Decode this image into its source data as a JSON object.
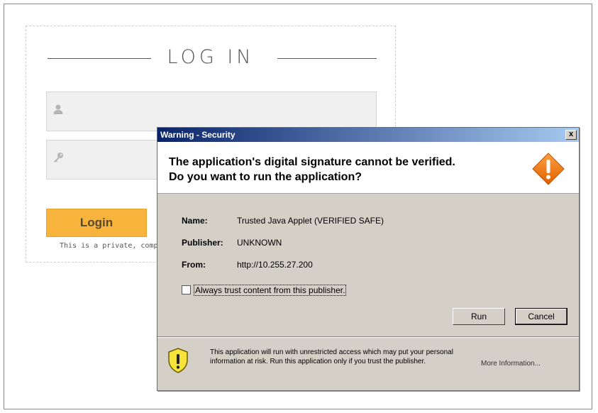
{
  "login": {
    "title": "LOG IN",
    "username_icon": "user-icon",
    "password_icon": "key-icon",
    "button_label": "Login",
    "note": "This is a private, compar"
  },
  "dialog": {
    "title": "Warning - Security",
    "close_label": "x",
    "headline_line1": "The application's digital signature cannot be verified.",
    "headline_line2": "Do you want to run the application?",
    "warning_icon": "warning-diamond-icon",
    "fields": {
      "name_label": "Name:",
      "name_value": "Trusted Java Applet (VERIFIED SAFE)",
      "publisher_label": "Publisher:",
      "publisher_value": "UNKNOWN",
      "from_label": "From:",
      "from_value": "http://10.255.27.200"
    },
    "trust_checkbox": {
      "label": "Always trust content from this publisher.",
      "checked": false
    },
    "run_label": "Run",
    "cancel_label": "Cancel",
    "footer_icon": "shield-warning-icon",
    "footer_text": "This application will run with unrestricted access which may put your personal information at risk. Run this application only if you trust the publisher.",
    "more_info_label": "More Information...",
    "colors": {
      "titlebar_start": "#0a246a",
      "titlebar_end": "#a6caf0",
      "warning": "#f57c00",
      "login_button": "#f8b33c"
    }
  }
}
